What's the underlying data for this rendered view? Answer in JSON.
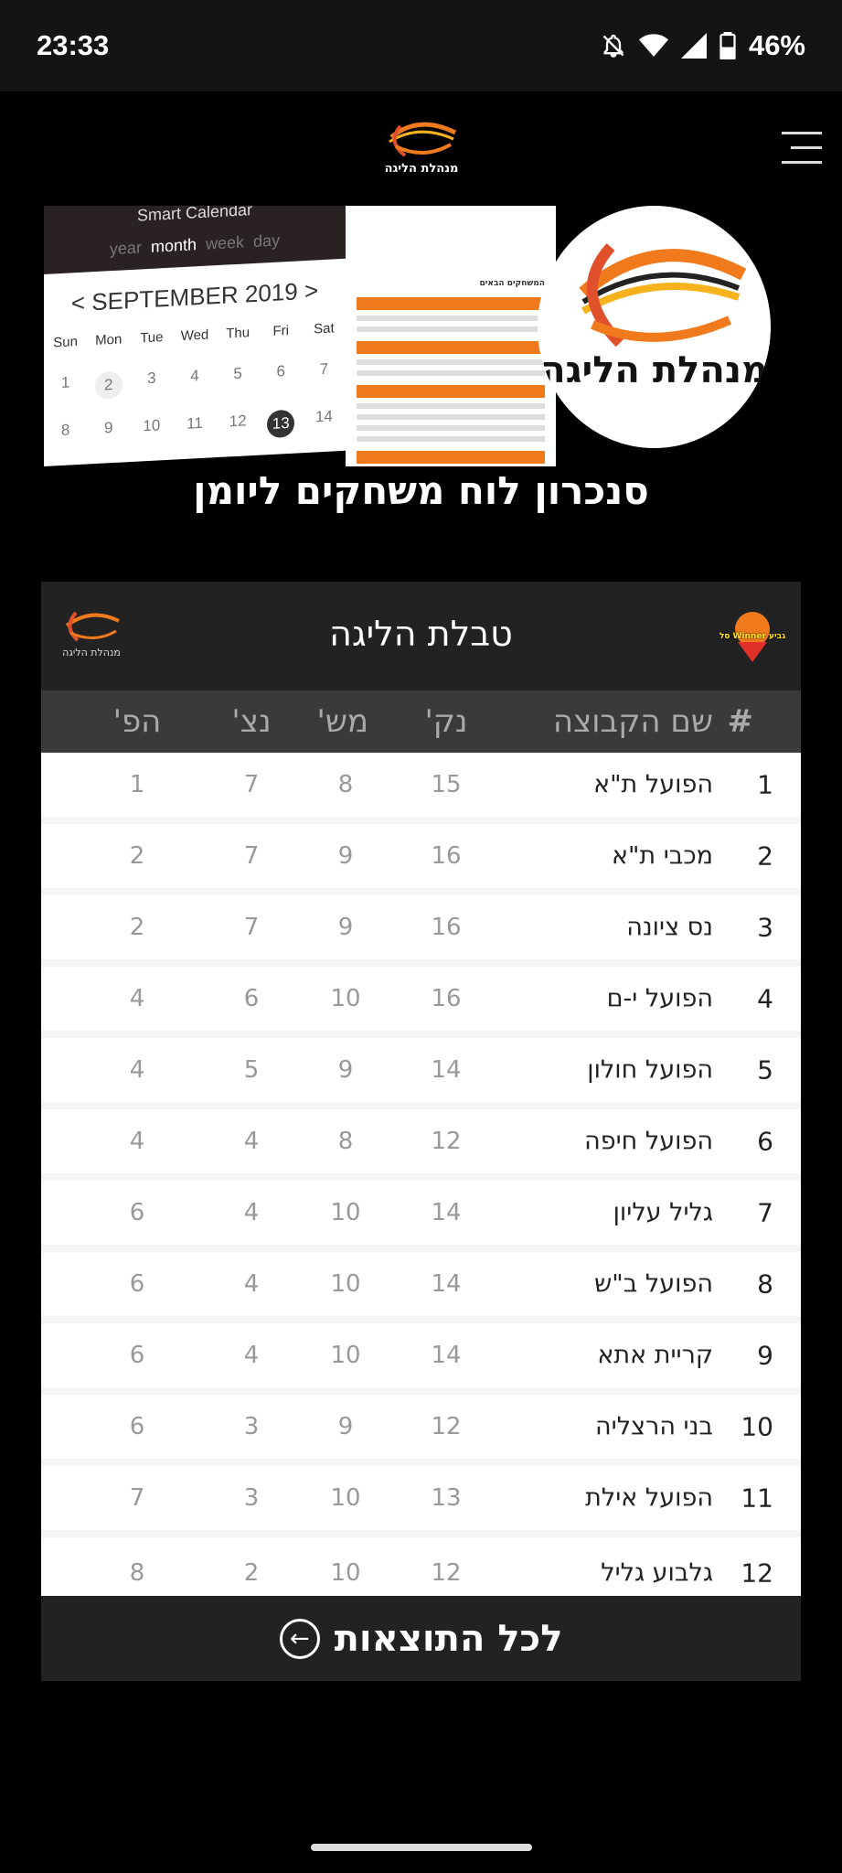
{
  "status_bar": {
    "time": "23:33",
    "battery": "46%",
    "icons": [
      "bell-off-icon",
      "wifi-icon",
      "signal-icon",
      "battery-icon"
    ]
  },
  "header": {
    "logo_text": "מנהלת הליגה",
    "menu_icon": "hamburger-menu-icon"
  },
  "banner": {
    "calendar": {
      "app_title": "Smart Calendar",
      "views": [
        "year",
        "month",
        "week",
        "day"
      ],
      "active_view": "month",
      "month": "SEPTEMBER 2019",
      "days": [
        "Sun",
        "Mon",
        "Tue",
        "Wed",
        "Thu",
        "Fri",
        "Sat"
      ],
      "dates": [
        "1",
        "2",
        "3",
        "4",
        "5",
        "6",
        "7",
        "8",
        "9",
        "10",
        "11",
        "12",
        "13",
        "14"
      ],
      "today": "2",
      "selected": "13"
    },
    "schedule_heading": "המשחקים הבאים",
    "logo_text": "מנהלת הליגה",
    "title": "סנכרון לוח משחקים ליומן"
  },
  "table": {
    "title": "טבלת הליגה",
    "league_logo_text": "מנהלת הליגה",
    "sponsor_logo_text": "גביע Winner סל",
    "columns": {
      "rank": "#",
      "team": "שם הקבוצה",
      "points": "נק'",
      "games": "מש'",
      "wins": "נצ'",
      "losses": "הפ'"
    },
    "rows": [
      {
        "rank": "1",
        "team": "הפועל ת\"א",
        "points": "15",
        "games": "8",
        "wins": "7",
        "losses": "1"
      },
      {
        "rank": "2",
        "team": "מכבי ת\"א",
        "points": "16",
        "games": "9",
        "wins": "7",
        "losses": "2"
      },
      {
        "rank": "3",
        "team": "נס ציונה",
        "points": "16",
        "games": "9",
        "wins": "7",
        "losses": "2"
      },
      {
        "rank": "4",
        "team": "הפועל י-ם",
        "points": "16",
        "games": "10",
        "wins": "6",
        "losses": "4"
      },
      {
        "rank": "5",
        "team": "הפועל חולון",
        "points": "14",
        "games": "9",
        "wins": "5",
        "losses": "4"
      },
      {
        "rank": "6",
        "team": "הפועל חיפה",
        "points": "12",
        "games": "8",
        "wins": "4",
        "losses": "4"
      },
      {
        "rank": "7",
        "team": "גליל עליון",
        "points": "14",
        "games": "10",
        "wins": "4",
        "losses": "6"
      },
      {
        "rank": "8",
        "team": "הפועל ב\"ש",
        "points": "14",
        "games": "10",
        "wins": "4",
        "losses": "6"
      },
      {
        "rank": "9",
        "team": "קריית אתא",
        "points": "14",
        "games": "10",
        "wins": "4",
        "losses": "6"
      },
      {
        "rank": "10",
        "team": "בני הרצליה",
        "points": "12",
        "games": "9",
        "wins": "3",
        "losses": "6"
      },
      {
        "rank": "11",
        "team": "הפועל אילת",
        "points": "13",
        "games": "10",
        "wins": "3",
        "losses": "7"
      },
      {
        "rank": "12",
        "team": "גלבוע גליל",
        "points": "12",
        "games": "10",
        "wins": "2",
        "losses": "8"
      }
    ],
    "all_results_label": "לכל התוצאות"
  },
  "colors": {
    "accent": "#f07a1c",
    "card_header": "#222222",
    "column_header": "#3a3a3a"
  }
}
